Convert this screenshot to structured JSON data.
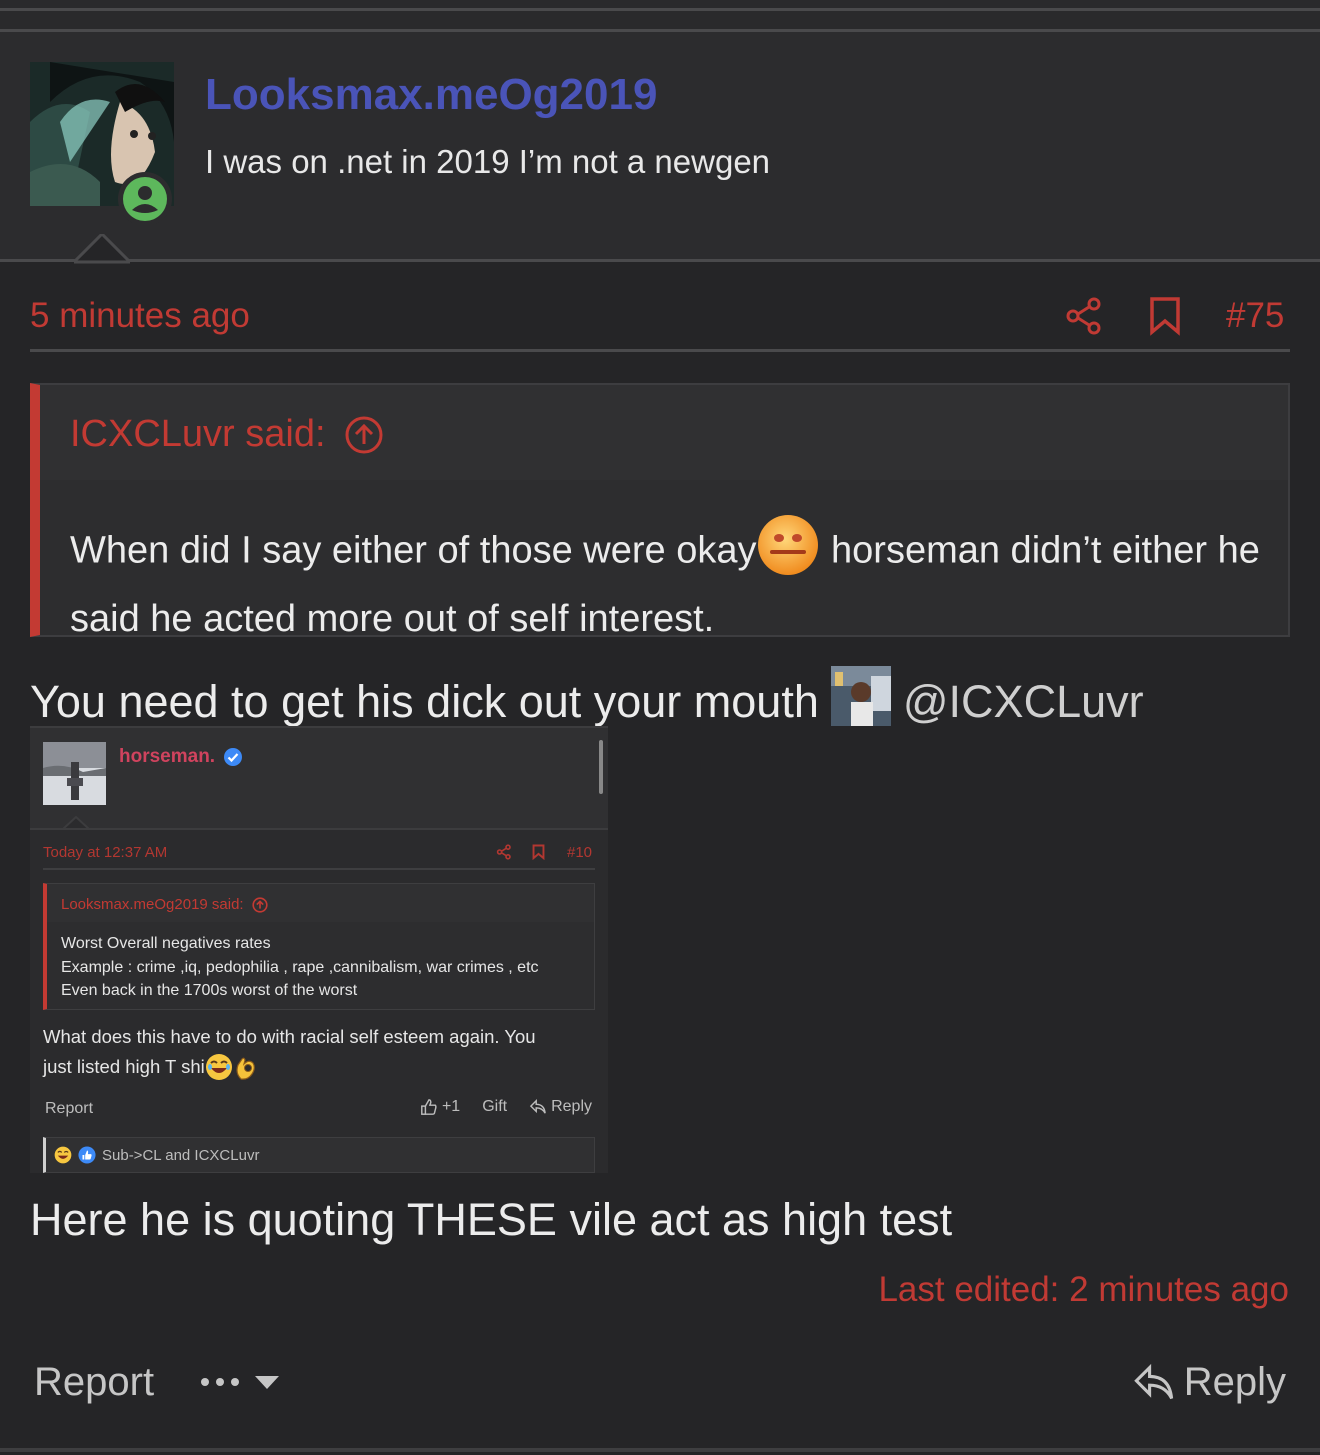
{
  "post": {
    "username": "Looksmax.meOg2019",
    "user_title": "I was on .net in 2019 I’m not a newgen",
    "time_ago": "5 minutes ago",
    "post_number": "#75",
    "quote": {
      "author": "ICXCLuvr said:",
      "text_part1": "When did I say either of those were okay",
      "text_part2": " horseman didn’t either he said he acted more out of self interest."
    },
    "body_line1": "You need to get his dick out your mouth",
    "mention": "@ICXCLuvr",
    "body_line2": "Here he is quoting THESE vile act as high test",
    "last_edited": "Last edited: 2 minutes ago",
    "report_label": "Report",
    "reply_label": "Reply"
  },
  "screenshot": {
    "username": "horseman.",
    "time": "Today at 12:37 AM",
    "post_number": "#10",
    "quote_author": "Looksmax.meOg2019 said:",
    "quote_lines": [
      "Worst Overall negatives rates",
      "Example : crime ,iq, pedophilia , rape ,cannibalism, war crimes , etc",
      "Even back in the 1700s worst of the worst"
    ],
    "body_line1": "What does this have to do with racial self esteem again. You",
    "body_line2": "just listed high T shi",
    "report": "Report",
    "like": "+1",
    "gift": "Gift",
    "reply": "Reply",
    "reactions_text": "Sub->CL and ICXCLuvr"
  },
  "colors": {
    "background": "#252527",
    "accent_red": "#c13a34",
    "username_blue": "#4a54b8",
    "screenshot_name_pink": "#d0435e",
    "online_green": "#5db85c"
  },
  "icons": [
    "online-status-icon",
    "share-icon",
    "bookmark-icon",
    "arrow-up-circle-icon",
    "cringe-emoji",
    "sticker-image",
    "verified-badge-icon",
    "thumbs-up-icon",
    "reply-arrow-icon",
    "laughing-emoji",
    "ok-hand-emoji",
    "like-reaction-icon",
    "more-dots-icon",
    "chevron-down-icon"
  ]
}
